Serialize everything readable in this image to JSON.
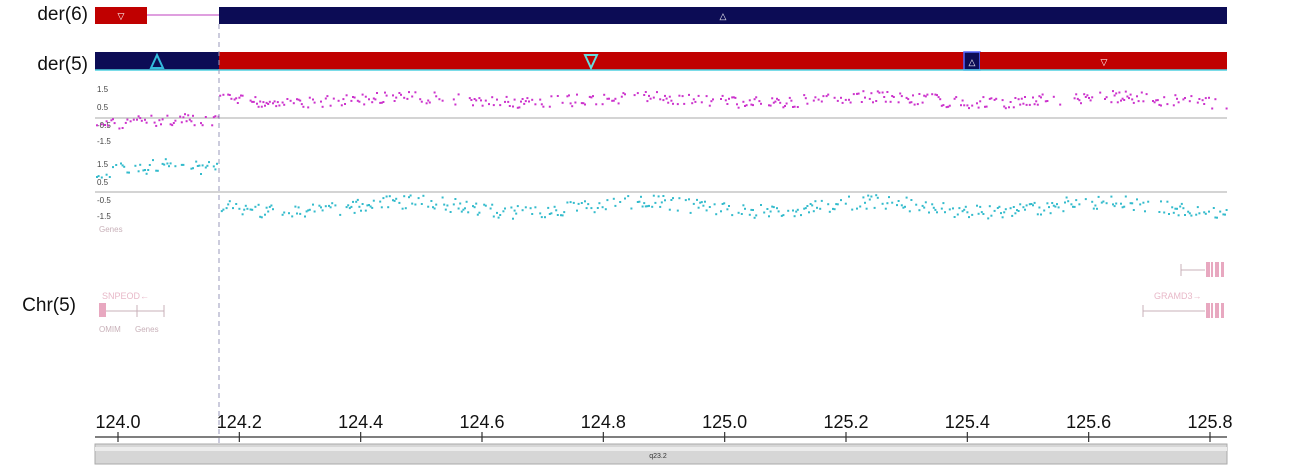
{
  "tracks": {
    "der6_label": "der(6)",
    "der5_label": "der(5)",
    "chr5_label": "Chr(5)"
  },
  "scatter_scales": {
    "upper": [
      "1.5",
      "0.5",
      "-0.5",
      "-1.5"
    ],
    "lower": [
      "1.5",
      "0.5",
      "-0.5",
      "-1.5"
    ]
  },
  "genes": {
    "track_label_left": "Genes",
    "omim_label": "OMIM",
    "genes_label_small": "Genes",
    "snpeod_label": "SNPEOD",
    "snpeod_arrow": "←",
    "gramd3_label": "GRAMD3",
    "gramd3_arrow": "→"
  },
  "axis": {
    "ticks": [
      "124.0",
      "124.2",
      "124.4",
      "124.6",
      "124.8",
      "125.0",
      "125.2",
      "125.4",
      "125.6",
      "125.8"
    ],
    "band_label": "q23.2"
  },
  "colors": {
    "navy": "#0c0c55",
    "red": "#c00000",
    "magenta": "#cc33cc",
    "cyan": "#33bbcc",
    "border_cyan": "#4fd0e0"
  }
}
